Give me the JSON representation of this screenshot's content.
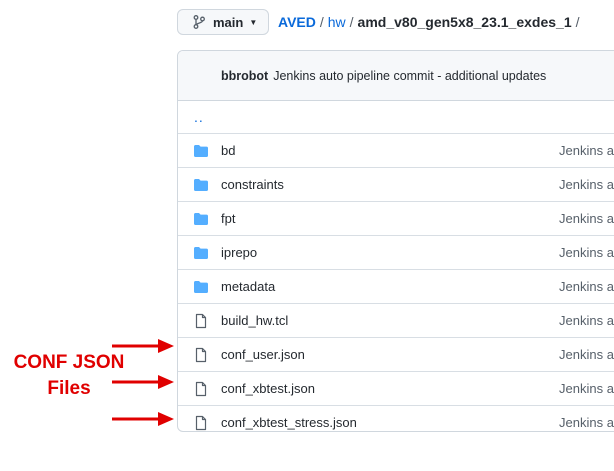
{
  "branch": {
    "label": "main"
  },
  "breadcrumb": {
    "root": "AVED",
    "hw": "hw",
    "current": "amd_v80_gen5x8_23.1_exdes_1",
    "separator": "/"
  },
  "commit": {
    "author": "bbrobot",
    "message": "Jenkins auto pipeline commit - additional updates"
  },
  "parent_dir": {
    "label": ".."
  },
  "files": [
    {
      "name": "bd",
      "type": "folder",
      "commit": "Jenkins au"
    },
    {
      "name": "constraints",
      "type": "folder",
      "commit": "Jenkins au"
    },
    {
      "name": "fpt",
      "type": "folder",
      "commit": "Jenkins au"
    },
    {
      "name": "iprepo",
      "type": "folder",
      "commit": "Jenkins au"
    },
    {
      "name": "metadata",
      "type": "folder",
      "commit": "Jenkins au"
    },
    {
      "name": "build_hw.tcl",
      "type": "file",
      "commit": "Jenkins au"
    },
    {
      "name": "conf_user.json",
      "type": "file",
      "commit": "Jenkins au"
    },
    {
      "name": "conf_xbtest.json",
      "type": "file",
      "commit": "Jenkins au"
    },
    {
      "name": "conf_xbtest_stress.json",
      "type": "file",
      "commit": "Jenkins au"
    }
  ],
  "annotation": {
    "line1": "CONF JSON",
    "line2": "Files",
    "color": "#e00000"
  },
  "colors": {
    "link": "#0969da",
    "folder": "#54aeff",
    "file_icon": "#57606a"
  }
}
